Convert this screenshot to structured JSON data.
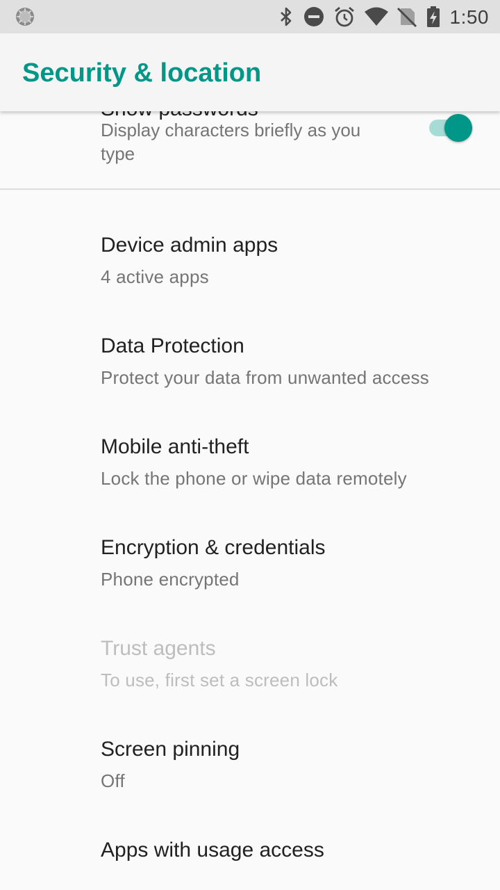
{
  "status_bar": {
    "time": "1:50",
    "icons": [
      "notification-spinner-icon",
      "bluetooth-icon",
      "do-not-disturb-icon",
      "alarm-icon",
      "wifi-icon",
      "no-sim-icon",
      "battery-charging-icon"
    ]
  },
  "app_bar": {
    "title": "Security & location"
  },
  "partial_item": {
    "title": "Show passwords",
    "summary": "Display characters briefly as you type",
    "toggle_on": true
  },
  "items": [
    {
      "title": "Device admin apps",
      "summary": "4 active apps",
      "enabled": true
    },
    {
      "title": "Data Protection",
      "summary": "Protect your data from unwanted access",
      "enabled": true
    },
    {
      "title": "Mobile anti-theft",
      "summary": "Lock the phone or wipe data remotely",
      "enabled": true
    },
    {
      "title": "Encryption & credentials",
      "summary": "Phone encrypted",
      "enabled": true
    },
    {
      "title": "Trust agents",
      "summary": "To use, first set a screen lock",
      "enabled": false
    },
    {
      "title": "Screen pinning",
      "summary": "Off",
      "enabled": true
    },
    {
      "title": "Apps with usage access",
      "summary": "",
      "enabled": true
    }
  ],
  "colors": {
    "accent": "#009688",
    "toggle_track": "#a7dcd6",
    "background": "#fafafa"
  }
}
